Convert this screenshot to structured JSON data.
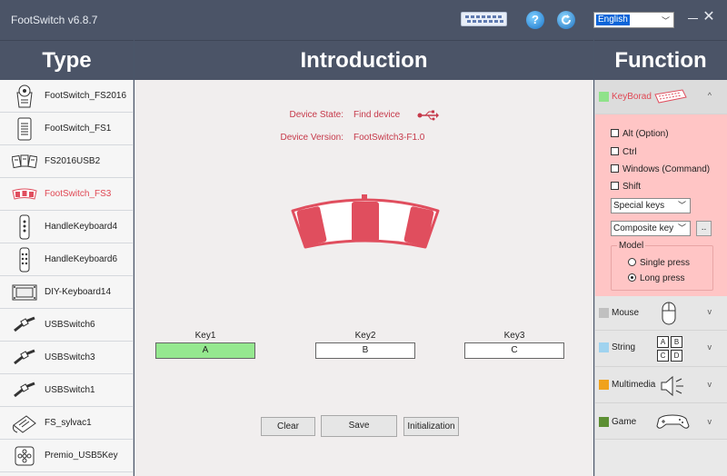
{
  "window": {
    "title": "FootSwitch v6.8.7"
  },
  "titlebar": {
    "language": "English",
    "dropdown_arrow": "﹀",
    "close": "✕"
  },
  "headers": {
    "type": "Type",
    "introduction": "Introduction",
    "function": "Function"
  },
  "types": [
    {
      "label": "FootSwitch_FS2016",
      "icon": "dial-pedal-icon"
    },
    {
      "label": "FootSwitch_FS1",
      "icon": "single-pedal-icon"
    },
    {
      "label": "FS2016USB2",
      "icon": "multi-pedal-icon"
    },
    {
      "label": "FootSwitch_FS3",
      "icon": "triple-pedal-icon",
      "active": true
    },
    {
      "label": "HandleKeyboard4",
      "icon": "handle-keyboard-icon"
    },
    {
      "label": "HandleKeyboard6",
      "icon": "handle-keyboard-icon"
    },
    {
      "label": "DIY-Keyboard14",
      "icon": "diy-board-icon"
    },
    {
      "label": "USBSwitch6",
      "icon": "usb-cable-icon"
    },
    {
      "label": "USBSwitch3",
      "icon": "usb-cable-icon"
    },
    {
      "label": "USBSwitch1",
      "icon": "usb-cable-icon"
    },
    {
      "label": "FS_sylvac1",
      "icon": "sylvac-pedal-icon"
    },
    {
      "label": "Premio_USB5Key",
      "icon": "five-key-icon"
    }
  ],
  "device": {
    "state_label": "Device State:",
    "state_value": "Find device",
    "version_label": "Device Version:",
    "version_value": "FootSwitch3-F1.0"
  },
  "keys": [
    {
      "label": "Key1",
      "value": "A",
      "selected": true
    },
    {
      "label": "Key2",
      "value": "B",
      "selected": false
    },
    {
      "label": "Key3",
      "value": "C",
      "selected": false
    }
  ],
  "buttons": {
    "clear": "Clear",
    "save": "Save",
    "initialization": "Initialization"
  },
  "function": {
    "keyboard": {
      "label": "KeyBorad",
      "color": "#8fe28a",
      "expand": "^",
      "modifiers": [
        "Alt (Option)",
        "Ctrl",
        "Windows (Command)",
        "Shift"
      ],
      "special_keys": "Special keys",
      "composite_key": "Composite key",
      "more_button": "..",
      "model_label": "Model",
      "modes": [
        "Single press",
        "Long press"
      ],
      "selected_mode": "Long press"
    },
    "rows": [
      {
        "label": "Mouse",
        "color": "#c0c0c0",
        "chevron": "v"
      },
      {
        "label": "String",
        "color": "#9fd3ef",
        "chevron": "v",
        "icon_keys": [
          "A",
          "B",
          "C",
          "D"
        ]
      },
      {
        "label": "Multimedia",
        "color": "#f0a21c",
        "chevron": "v"
      },
      {
        "label": "Game",
        "color": "#5c8f33",
        "chevron": "v"
      }
    ]
  },
  "colors": {
    "accent": "#e04854",
    "header_bg": "#4b5467",
    "pedal": "#e04e5e"
  }
}
